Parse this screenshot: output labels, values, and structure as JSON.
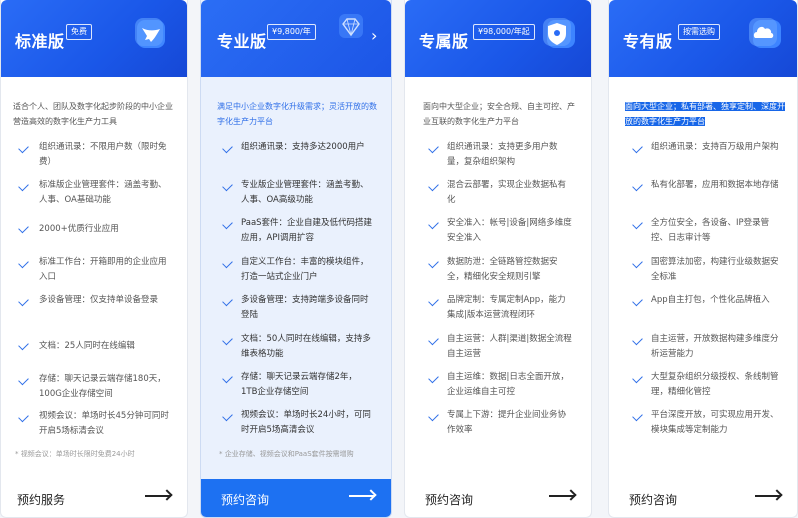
{
  "plans": [
    {
      "title": "标准版",
      "badge": "免费",
      "icon": "bird-icon",
      "description": "适合个人、团队及数字化起步阶段的中小企业营造高效的数字化生产力工具",
      "features": [
        "组织通讯录：不限用户数（限时免费）",
        "标准版企业管理套件：涵盖考勤、人事、OA基础功能",
        "2000+优质行业应用",
        "标准工作台：开箱即用的企业应用入口",
        "多设备管理：仅支持单设备登录",
        "文档：25人同时在线编辑",
        "存储：聊天记录云端存储180天，100G企业存储空间",
        "视频会议：单场时长45分钟可同时开启5场标清会议"
      ],
      "note": "* 视频会议：单场时长限时免费24小时",
      "cta": "预约服务"
    },
    {
      "title": "专业版",
      "badge": "¥9,800/年",
      "icon": "diamond-icon",
      "description": "满足中小企业数字化升级需求；灵活开放的数字化生产力平台",
      "features": [
        "组织通讯录：支持多达2000用户",
        "专业版企业管理套件：涵盖考勤、人事、OA高级功能",
        "PaaS套件：企业自建及低代码搭建应用，API调用扩容",
        "自定义工作台：丰富的模块组件，打造一站式企业门户",
        "多设备管理：支持跨端多设备同时登陆",
        "文档：50人同时在线编辑，支持多维表格功能",
        "存储：聊天记录云端存储2年，1TB企业存储空间",
        "视频会议：单场时长24小时，可同时开启5场高清会议"
      ],
      "note": "* 企业存储、视频会议和PaaS套件按需增购",
      "cta": "预约咨询"
    },
    {
      "title": "专属版",
      "badge": "¥98,000/年起",
      "icon": "shield-icon",
      "description": "面向中大型企业；安全合规、自主可控、产业互联的数字化生产力平台",
      "features": [
        "组织通讯录：支持更多用户数量，复杂组织架构",
        "混合云部署，实现企业数据私有化",
        "安全准入：帐号|设备|网络多维度安全准入",
        "数据防泄：全链路管控数据安全，精细化安全规则引擎",
        "品牌定制：专属定制App，能力集成|版本运营流程闭环",
        "自主运营：人群|渠道|数据全流程自主运营",
        "自主运维：数据|日志全面开放，企业运维自主可控",
        "专属上下游：提升企业间业务协作效率"
      ],
      "note": "",
      "cta": "预约咨询"
    },
    {
      "title": "专有版",
      "badge": "按需选购",
      "icon": "cloud-icon",
      "description": "面向大型企业；私有部署、独享定制、深度开放的数字化生产力平台",
      "features": [
        "组织通讯录：支持百万级用户架构",
        "私有化部署，应用和数据本地存储",
        "全方位安全，各设备、IP登录管控、日志审计等",
        "国密算法加密，构建行业级数据安全标准",
        "App自主打包，个性化品牌植入",
        "自主运营，开放数据构建多维度分析运营能力",
        "大型复杂组织分级授权、条线制管理，精细化管控",
        "平台深度开放，可实现应用开发、模块集成等定制能力"
      ],
      "note": "",
      "cta": "预约咨询"
    }
  ],
  "colors": {
    "header_blue": "#1a57e8",
    "highlight_card_bg": "#eaf1fd",
    "cta_active": "#1d71f2",
    "check": "#2f6fe8"
  }
}
